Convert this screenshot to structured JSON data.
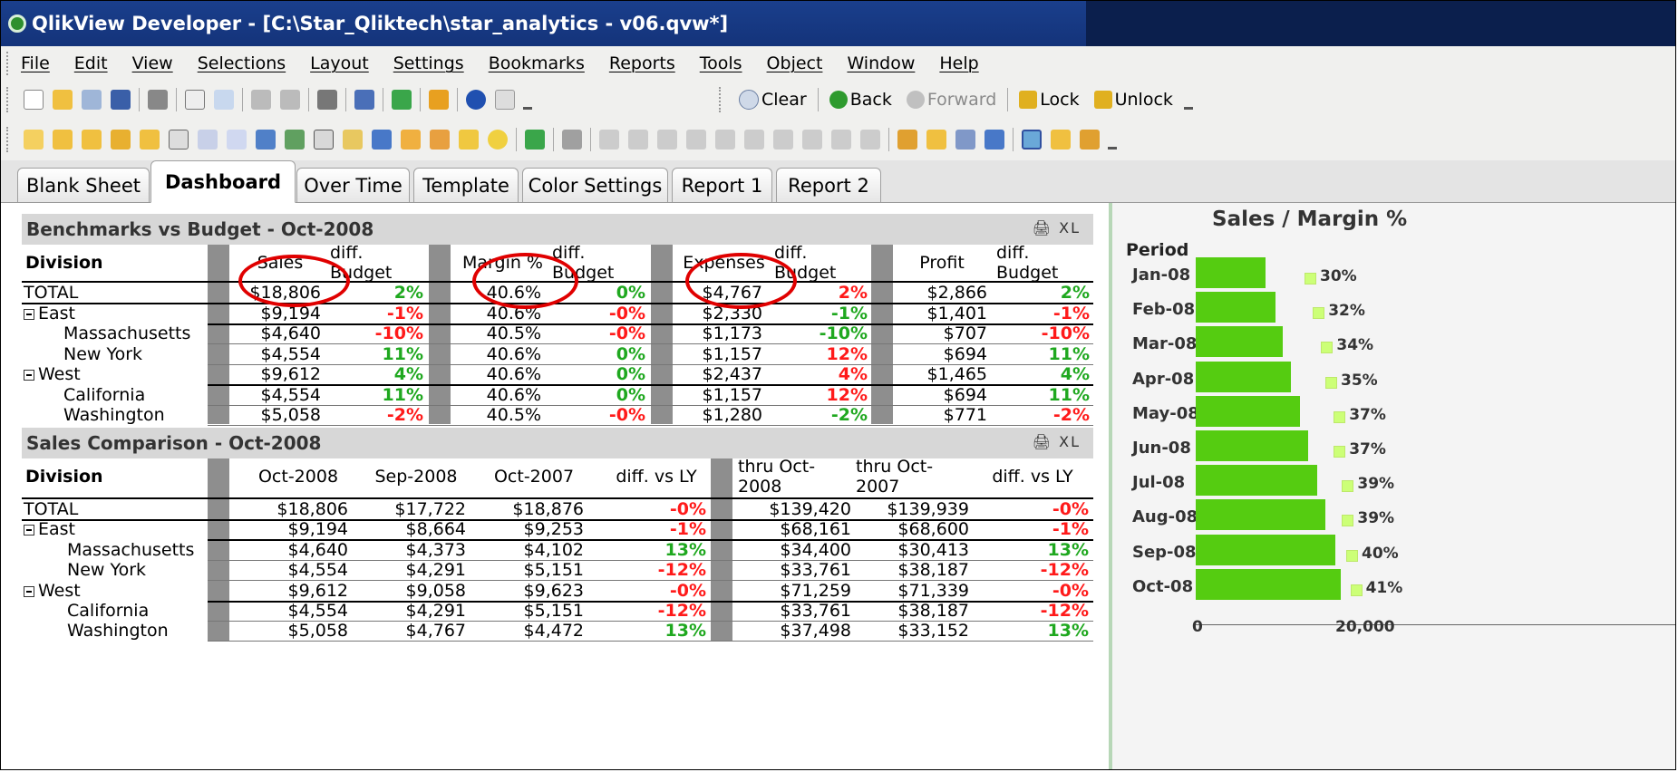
{
  "window": {
    "title": "QlikView Developer - [C:\\Star_Qliktech\\star_analytics - v06.qvw*]"
  },
  "menu": [
    "File",
    "Edit",
    "View",
    "Selections",
    "Layout",
    "Settings",
    "Bookmarks",
    "Reports",
    "Tools",
    "Object",
    "Window",
    "Help"
  ],
  "toolbar1": {
    "clear": "Clear",
    "back": "Back",
    "forward": "Forward",
    "lock": "Lock",
    "unlock": "Unlock"
  },
  "tabs": [
    "Blank Sheet",
    "Dashboard",
    "Over Time",
    "Template",
    "Color Settings",
    "Report 1",
    "Report 2"
  ],
  "active_tab": "Dashboard",
  "benchmarks": {
    "caption": "Benchmarks vs Budget - Oct-2008",
    "caption_icons": "🖨 XL",
    "headers": [
      "Division",
      "Sales",
      "diff. Budget",
      "Margin %",
      "diff. Budget",
      "Expenses",
      "diff. Budget",
      "Profit",
      "diff. Budget"
    ],
    "rows": [
      {
        "division": "TOTAL",
        "level": 0,
        "sales": "$18,806",
        "s_diff": "2%",
        "margin": "40.6%",
        "m_diff": "0%",
        "expenses": "$4,767",
        "e_diff": "2%",
        "profit": "$2,866",
        "p_diff": "2%"
      },
      {
        "division": "East",
        "level": 0,
        "expand": true,
        "sales": "$9,194",
        "s_diff": "-1%",
        "margin": "40.6%",
        "m_diff": "-0%",
        "expenses": "$2,330",
        "e_diff": "-1%",
        "profit": "$1,401",
        "p_diff": "-1%"
      },
      {
        "division": "Massachusetts",
        "level": 1,
        "sales": "$4,640",
        "s_diff": "-10%",
        "margin": "40.5%",
        "m_diff": "-0%",
        "expenses": "$1,173",
        "e_diff": "-10%",
        "profit": "$707",
        "p_diff": "-10%"
      },
      {
        "division": "New York",
        "level": 1,
        "sales": "$4,554",
        "s_diff": "11%",
        "margin": "40.6%",
        "m_diff": "0%",
        "expenses": "$1,157",
        "e_diff": "12%",
        "profit": "$694",
        "p_diff": "11%"
      },
      {
        "division": "West",
        "level": 0,
        "expand": true,
        "sales": "$9,612",
        "s_diff": "4%",
        "margin": "40.6%",
        "m_diff": "0%",
        "expenses": "$2,437",
        "e_diff": "4%",
        "profit": "$1,465",
        "p_diff": "4%"
      },
      {
        "division": "California",
        "level": 1,
        "sales": "$4,554",
        "s_diff": "11%",
        "margin": "40.6%",
        "m_diff": "0%",
        "expenses": "$1,157",
        "e_diff": "12%",
        "profit": "$694",
        "p_diff": "11%"
      },
      {
        "division": "Washington",
        "level": 1,
        "sales": "$5,058",
        "s_diff": "-2%",
        "margin": "40.5%",
        "m_diff": "-0%",
        "expenses": "$1,280",
        "e_diff": "-2%",
        "profit": "$771",
        "p_diff": "-2%"
      }
    ],
    "colors": {
      "s_diff": [
        "pos",
        "neg",
        "neg",
        "pos",
        "pos",
        "pos",
        "neg"
      ],
      "m_diff": [
        "pos",
        "neg",
        "neg",
        "pos",
        "pos",
        "pos",
        "neg"
      ],
      "e_diff": [
        "neg",
        "pos",
        "pos",
        "neg",
        "neg",
        "neg",
        "pos"
      ],
      "p_diff": [
        "pos",
        "neg",
        "neg",
        "pos",
        "pos",
        "pos",
        "neg"
      ]
    }
  },
  "comparison": {
    "caption": "Sales Comparison - Oct-2008",
    "caption_icons": "🖨 XL",
    "headers": [
      "Division",
      "Oct-2008",
      "Sep-2008",
      "Oct-2007",
      "diff. vs LY",
      "thru Oct-2008",
      "thru Oct-2007",
      "diff. vs LY"
    ],
    "rows": [
      {
        "division": "TOTAL",
        "level": 0,
        "oct08": "$18,806",
        "sep08": "$17,722",
        "oct07": "$18,876",
        "d1": "-0%",
        "thru08": "$139,420",
        "thru07": "$139,939",
        "d2": "-0%"
      },
      {
        "division": "East",
        "level": 0,
        "expand": true,
        "oct08": "$9,194",
        "sep08": "$8,664",
        "oct07": "$9,253",
        "d1": "-1%",
        "thru08": "$68,161",
        "thru07": "$68,600",
        "d2": "-1%"
      },
      {
        "division": "Massachusetts",
        "level": 1,
        "oct08": "$4,640",
        "sep08": "$4,373",
        "oct07": "$4,102",
        "d1": "13%",
        "thru08": "$34,400",
        "thru07": "$30,413",
        "d2": "13%"
      },
      {
        "division": "New York",
        "level": 1,
        "oct08": "$4,554",
        "sep08": "$4,291",
        "oct07": "$5,151",
        "d1": "-12%",
        "thru08": "$33,761",
        "thru07": "$38,187",
        "d2": "-12%"
      },
      {
        "division": "West",
        "level": 0,
        "expand": true,
        "oct08": "$9,612",
        "sep08": "$9,058",
        "oct07": "$9,623",
        "d1": "-0%",
        "thru08": "$71,259",
        "thru07": "$71,339",
        "d2": "-0%"
      },
      {
        "division": "California",
        "level": 1,
        "oct08": "$4,554",
        "sep08": "$4,291",
        "oct07": "$5,151",
        "d1": "-12%",
        "thru08": "$33,761",
        "thru07": "$38,187",
        "d2": "-12%"
      },
      {
        "division": "Washington",
        "level": 1,
        "oct08": "$5,058",
        "sep08": "$4,767",
        "oct07": "$4,472",
        "d1": "13%",
        "thru08": "$37,498",
        "thru07": "$33,152",
        "d2": "13%"
      }
    ],
    "colors": {
      "d1": [
        "neg",
        "neg",
        "pos",
        "neg",
        "neg",
        "neg",
        "pos"
      ],
      "d2": [
        "neg",
        "neg",
        "pos",
        "neg",
        "neg",
        "neg",
        "pos"
      ]
    }
  },
  "chart_data": {
    "type": "bar",
    "orientation": "horizontal",
    "title": "Sales / Margin %",
    "ylabel": "Period",
    "categories": [
      "Jan-08",
      "Feb-08",
      "Mar-08",
      "Apr-08",
      "May-08",
      "Jun-08",
      "Jul-08",
      "Aug-08",
      "Sep-08",
      "Oct-08"
    ],
    "series": [
      {
        "values": [
          9100,
          10300,
          11300,
          12400,
          13500,
          14600,
          15800,
          16800,
          18100,
          18806
        ]
      },
      {
        "values": [
          "30%",
          "32%",
          "34%",
          "35%",
          "37%",
          "37%",
          "39%",
          "39%",
          "40%",
          "41%"
        ]
      }
    ],
    "xlim": [
      0,
      20000
    ],
    "xticks": [
      "0",
      "20,000"
    ],
    "colors": {
      "bar": "#55cc11",
      "marker": "#ccff77"
    }
  }
}
